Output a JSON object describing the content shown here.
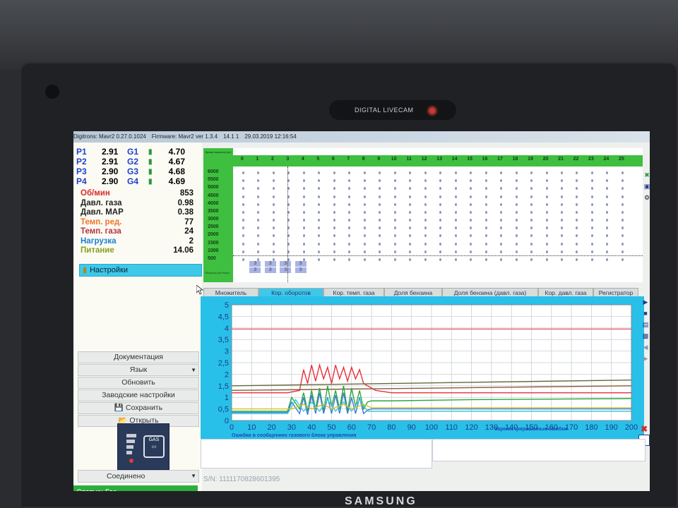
{
  "window": {
    "title_parts": [
      "Digitrons: Mavr2 0.27.0.1024",
      "Firmware: Mavr2 ver 1.3.4",
      "14.1 1",
      "29.03.2019 12:16:54"
    ]
  },
  "monitor": {
    "webcam_label": "DIGITAL LIVECAM",
    "brand": "SAMSUNG"
  },
  "pressures": [
    {
      "p_label": "P1",
      "p_value": "2.91",
      "g_label": "G1",
      "g_value": "4.70"
    },
    {
      "p_label": "P2",
      "p_value": "2.91",
      "g_label": "G2",
      "g_value": "4.67"
    },
    {
      "p_label": "P3",
      "p_value": "2.90",
      "g_label": "G3",
      "g_value": "4.68"
    },
    {
      "p_label": "P4",
      "p_value": "2.90",
      "g_label": "G4",
      "g_value": "4.69"
    }
  ],
  "params": [
    {
      "label": "Об/мин",
      "value": "853",
      "color": "#d82a2a"
    },
    {
      "label": "Давл. газа",
      "value": "0.98",
      "color": "#222222"
    },
    {
      "label": "Давл. MAP",
      "value": "0.38",
      "color": "#222222"
    },
    {
      "label": "Темп. ред.",
      "value": "77",
      "color": "#f0742a"
    },
    {
      "label": "Темп. газа",
      "value": "24",
      "color": "#b8323a"
    },
    {
      "label": "Нагрузка",
      "value": "2",
      "color": "#1d7fd0"
    },
    {
      "label": "Питание",
      "value": "14.06",
      "color": "#86a01e"
    }
  ],
  "sidebar": {
    "settings": "Настройки",
    "documentation": "Документация",
    "language": "Язык",
    "refresh": "Обновить",
    "factory": "Заводские настройки",
    "save": "Сохранить",
    "open": "Открыть",
    "connection": "Соединено",
    "status": "Статус: Газ"
  },
  "map": {
    "corner_label": "Время впрыска (мс)",
    "axis_sub_label": "Обороты (об./мин.)",
    "columns": [
      "0",
      "1",
      "2",
      "3",
      "4",
      "5",
      "6",
      "7",
      "8",
      "9",
      "10",
      "11",
      "12",
      "13",
      "14",
      "15",
      "16",
      "17",
      "18",
      "19",
      "20",
      "21",
      "22",
      "23",
      "24",
      "25"
    ],
    "rows": [
      "6000",
      "5500",
      "5000",
      "4500",
      "4000",
      "3500",
      "3000",
      "2500",
      "2000",
      "1500",
      "1000",
      "500"
    ],
    "cell_values": [
      "3",
      "3",
      "3",
      "3",
      "3",
      "3",
      "3",
      "3"
    ]
  },
  "tabs": [
    "Множитель",
    "Кор. оборотов",
    "Кор. темп. газа",
    "Доля бензина",
    "Доля бензина (давл. газа)",
    "Кор. давл. газа",
    "Регистратор"
  ],
  "active_tab": 1,
  "chart_data": {
    "type": "line",
    "x_ticks": [
      "0",
      "10",
      "20",
      "30",
      "40",
      "50",
      "60",
      "70",
      "80",
      "90",
      "100",
      "110",
      "120",
      "130",
      "140",
      "150",
      "160",
      "170",
      "180",
      "190",
      "200"
    ],
    "y_ticks": [
      "0",
      "0,5",
      "1",
      "1,5",
      "2",
      "2,5",
      "3",
      "3,5",
      "4",
      "4,5",
      "5"
    ],
    "xlim": [
      0,
      200
    ],
    "ylim": [
      0,
      5
    ],
    "grid": true,
    "series": [
      {
        "color": "#f0606a",
        "x": [
          0,
          40,
          80,
          120,
          160,
          200
        ],
        "y": [
          3.95,
          3.95,
          3.95,
          3.95,
          3.95,
          3.95
        ]
      },
      {
        "color": "#e8303a",
        "x": [
          0,
          28,
          34,
          36,
          38,
          40,
          42,
          44,
          46,
          48,
          50,
          52,
          54,
          56,
          58,
          60,
          62,
          64,
          66,
          68,
          72,
          80,
          100,
          140,
          200
        ],
        "y": [
          1.2,
          1.2,
          1.3,
          2.2,
          1.6,
          2.4,
          1.7,
          2.4,
          1.8,
          2.3,
          1.6,
          2.4,
          1.8,
          2.3,
          1.7,
          2.3,
          1.8,
          2.2,
          1.6,
          1.5,
          1.3,
          1.2,
          1.2,
          1.2,
          1.2
        ]
      },
      {
        "color": "#666a3a",
        "x": [
          0,
          200
        ],
        "y": [
          1.5,
          1.75
        ]
      },
      {
        "color": "#8a5a3a",
        "x": [
          0,
          200
        ],
        "y": [
          1.3,
          1.5
        ]
      },
      {
        "color": "#2aa83a",
        "x": [
          0,
          28,
          30,
          34,
          36,
          38,
          40,
          42,
          44,
          46,
          48,
          50,
          52,
          54,
          56,
          58,
          60,
          62,
          64,
          66,
          68,
          70,
          80,
          120,
          200
        ],
        "y": [
          0.4,
          0.4,
          1.0,
          0.5,
          1.2,
          0.4,
          1.3,
          0.5,
          1.4,
          0.4,
          1.5,
          0.6,
          1.3,
          0.5,
          1.5,
          0.4,
          1.4,
          0.6,
          1.3,
          0.5,
          0.8,
          0.85,
          0.85,
          0.9,
          0.95
        ]
      },
      {
        "color": "#3a7ae0",
        "x": [
          0,
          28,
          30,
          34,
          36,
          38,
          40,
          42,
          44,
          46,
          48,
          50,
          52,
          54,
          56,
          58,
          60,
          62,
          64,
          66,
          68,
          70,
          120,
          200
        ],
        "y": [
          0.35,
          0.35,
          0.8,
          0.3,
          1.0,
          0.25,
          1.1,
          0.3,
          1.2,
          0.3,
          1.0,
          0.3,
          1.1,
          0.3,
          1.2,
          0.3,
          1.0,
          0.3,
          1.0,
          0.3,
          0.45,
          0.5,
          0.5,
          0.5
        ]
      },
      {
        "color": "#39c9d0",
        "x": [
          0,
          28,
          32,
          36,
          40,
          44,
          48,
          52,
          56,
          60,
          64,
          68,
          200
        ],
        "y": [
          0.3,
          0.3,
          0.9,
          0.4,
          0.8,
          0.4,
          0.9,
          0.4,
          0.8,
          0.4,
          0.9,
          0.4,
          0.4
        ]
      },
      {
        "color": "#d8c020",
        "x": [
          0,
          30,
          36,
          40,
          46,
          50,
          56,
          60,
          66,
          70,
          200
        ],
        "y": [
          0.5,
          0.5,
          0.7,
          0.5,
          0.7,
          0.5,
          0.7,
          0.5,
          0.7,
          0.55,
          0.55
        ]
      }
    ]
  },
  "errors": {
    "left_title": "Ошибки в сообщениях газового блока управления",
    "right_title": "Зарегистрированные ошибки",
    "serial": "S/N: 1111170828601395"
  }
}
